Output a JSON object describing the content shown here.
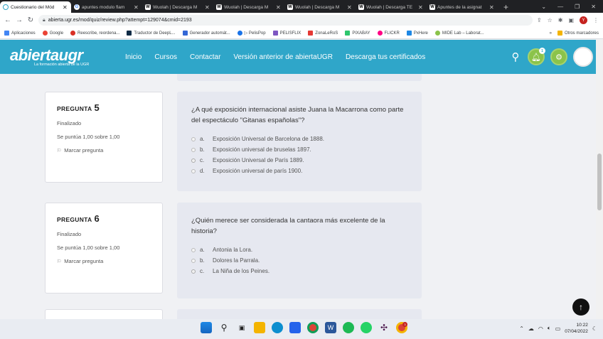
{
  "browser": {
    "tabs": [
      {
        "label": "Cuestionario del Mód",
        "icon": "moodle-icon",
        "active": true
      },
      {
        "label": "apuntes modulo flam",
        "icon": "google-icon",
        "active": false
      },
      {
        "label": "Wuolah | Descarga M",
        "icon": "wuolah-icon",
        "active": false
      },
      {
        "label": "Wuolah | Descarga M",
        "icon": "wuolah-icon",
        "active": false
      },
      {
        "label": "Wuolah | Descarga M",
        "icon": "wuolah-icon",
        "active": false
      },
      {
        "label": "Wuolah | Descarga TE",
        "icon": "wuolah-icon",
        "active": false
      },
      {
        "label": "Apuntes de la asignat",
        "icon": "wuolah-icon",
        "active": false
      }
    ],
    "new_tab": "+",
    "url": "abierta.ugr.es/mod/quiz/review.php?attempt=129074&cmid=2193",
    "profile_initial": "Y",
    "bookmarks": [
      {
        "label": "Aplicaciones",
        "color": "#4285f4"
      },
      {
        "label": "Google",
        "color": "#ea4335"
      },
      {
        "label": "Reescribe, reordena...",
        "color": "#d93025"
      },
      {
        "label": "Traductor de DeepL...",
        "color": "#0f2b46"
      },
      {
        "label": "Generador automát...",
        "color": "#3367d6"
      },
      {
        "label": "▷ PelisPop",
        "color": "#1a73e8"
      },
      {
        "label": "PELISFLIX",
        "color": "#7e57c2"
      },
      {
        "label": "ZonaLeRoS",
        "color": "#e53935"
      },
      {
        "label": "PIXABAY",
        "color": "#2ec66d"
      },
      {
        "label": "FLICKR",
        "color": "#ff0084"
      },
      {
        "label": "PxHere",
        "color": "#1e88e5"
      },
      {
        "label": "MIDE Lab – Laborat...",
        "color": "#8bc34a"
      }
    ],
    "bookmarks_more": "»",
    "other_bookmarks": "Otros marcadores"
  },
  "site": {
    "logo": "abiertaugr",
    "logo_tagline": "La formación abierta de la UGR",
    "nav": [
      "Inicio",
      "Cursos",
      "Contactar",
      "Versión anterior de abiertaUGR",
      "Descarga tus certificados"
    ],
    "notification_count": "1",
    "accent": "#2fa6c9"
  },
  "questions": [
    {
      "label": "PREGUNTA",
      "number": "5",
      "state": "Finalizado",
      "grade": "Se puntúa 1,00 sobre 1,00",
      "flag": "Marcar pregunta",
      "text": "¿A qué exposición internacional asiste Juana la Macarrona como parte del espectáculo \"Gitanas españolas\"?",
      "answers": [
        {
          "letter": "a.",
          "text": "Exposición Universal de Barcelona de 1888.",
          "checked": false
        },
        {
          "letter": "b.",
          "text": "Exposición universal de bruselas 1897.",
          "checked": false
        },
        {
          "letter": "c.",
          "text": "Exposición Universal de París 1889.",
          "checked": true
        },
        {
          "letter": "d.",
          "text": "Exposición universal de parís 1900.",
          "checked": false
        }
      ]
    },
    {
      "label": "PREGUNTA",
      "number": "6",
      "state": "Finalizado",
      "grade": "Se puntúa 1,00 sobre 1,00",
      "flag": "Marcar pregunta",
      "text": "¿Quién merece ser considerada la cantaora más excelente de la historia?",
      "answers": [
        {
          "letter": "a.",
          "text": "Antonia la Lora.",
          "checked": false
        },
        {
          "letter": "b.",
          "text": "Dolores la Parrala.",
          "checked": false
        },
        {
          "letter": "c.",
          "text": "La Niña de los Peines.",
          "checked": true
        }
      ]
    }
  ],
  "taskbar": {
    "time": "10:22",
    "date": "07/04/2022",
    "chrome_badge": "3"
  }
}
